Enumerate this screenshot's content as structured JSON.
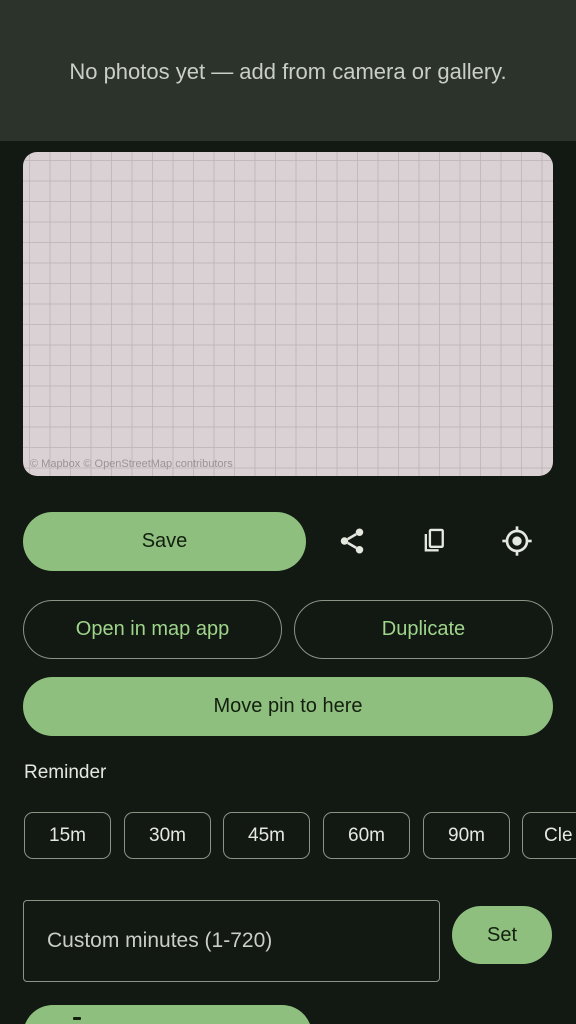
{
  "photos": {
    "empty_text": "No photos yet — add from camera or gallery."
  },
  "map": {
    "attribution": "© Mapbox © OpenStreetMap contributors"
  },
  "actions": {
    "save_label": "Save",
    "share_icon": "share-icon",
    "copy_icon": "copy-icon",
    "locate_icon": "my-location-icon",
    "open_in_map_label": "Open in map app",
    "duplicate_label": "Duplicate",
    "move_pin_label": "Move pin to here"
  },
  "reminder": {
    "label": "Reminder",
    "chips": [
      "15m",
      "30m",
      "45m",
      "60m",
      "90m",
      "Cle"
    ],
    "custom_placeholder": "Custom minutes (1-720)",
    "set_label": "Set"
  },
  "colors": {
    "background": "#121812",
    "banner": "#2b332b",
    "accent": "#8ebf7e",
    "outline_text": "#9fd48b",
    "map_tile": "#d9d1d4"
  }
}
